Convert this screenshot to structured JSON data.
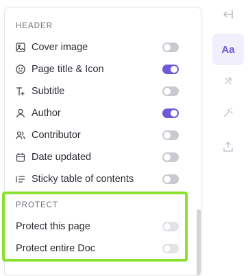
{
  "panel": {
    "header_section": {
      "title": "HEADER",
      "items": [
        {
          "label": "Cover image",
          "icon": "image-icon",
          "toggle": "off"
        },
        {
          "label": "Page title & Icon",
          "icon": "smiley-icon",
          "toggle": "on"
        },
        {
          "label": "Subtitle",
          "icon": "text-plus-icon",
          "toggle": "off"
        },
        {
          "label": "Author",
          "icon": "user-icon",
          "toggle": "on"
        },
        {
          "label": "Contributor",
          "icon": "users-icon",
          "toggle": "off"
        },
        {
          "label": "Date updated",
          "icon": "calendar-icon",
          "toggle": "off"
        },
        {
          "label": "Sticky table of contents",
          "icon": "list-icon",
          "toggle": "off"
        }
      ]
    },
    "protect_section": {
      "title": "PROTECT",
      "items": [
        {
          "label": "Protect this page",
          "toggle": "disabled-off"
        },
        {
          "label": "Protect entire Doc",
          "toggle": "disabled-off"
        }
      ]
    }
  },
  "right_rail": {
    "items": [
      {
        "icon": "collapse-left-icon"
      },
      {
        "icon": "text-style-icon",
        "label": "Aa",
        "active": true
      },
      {
        "icon": "swap-icon"
      },
      {
        "icon": "magic-wand-icon"
      },
      {
        "icon": "share-upload-icon"
      }
    ]
  },
  "colors": {
    "accent": "#6c5ad9",
    "toggle_off": "#c9c9cf",
    "highlight": "#8ae02e"
  }
}
